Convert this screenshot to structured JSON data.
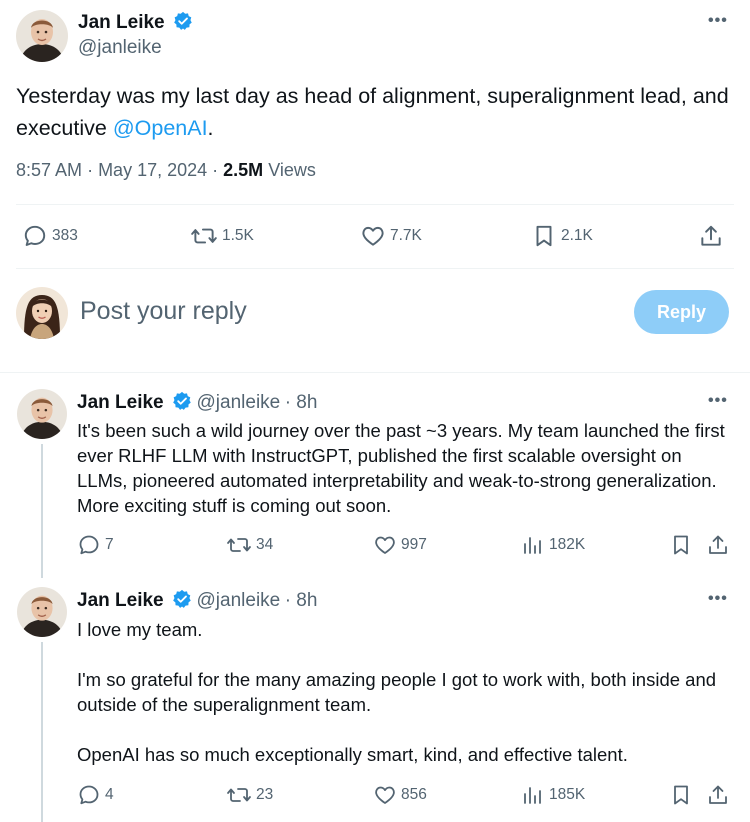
{
  "main_tweet": {
    "author_name": "Jan Leike",
    "author_handle": "@janleike",
    "text_prefix": "Yesterday was my last day as head of alignment, superalignment lead, and executive ",
    "mention": "@OpenAI",
    "text_suffix": ".",
    "time": "8:57 AM",
    "date": "May 17, 2024",
    "views_count": "2.5M",
    "views_label": "Views",
    "stats": {
      "replies": "383",
      "reposts": "1.5K",
      "likes": "7.7K",
      "bookmarks": "2.1K"
    }
  },
  "reply_box": {
    "placeholder": "Post your reply",
    "button_label": "Reply"
  },
  "replies": [
    {
      "author_name": "Jan Leike",
      "author_handle": "@janleike",
      "time_ago": "8h",
      "text": "It's been such a wild journey over the past ~3 years. My team launched the first ever RLHF LLM with InstructGPT, published the first scalable oversight on LLMs, pioneered automated interpretability and weak-to-strong generalization. More exciting stuff is coming out soon.",
      "stats": {
        "replies": "7",
        "reposts": "34",
        "likes": "997",
        "views": "182K"
      }
    },
    {
      "author_name": "Jan Leike",
      "author_handle": "@janleike",
      "time_ago": "8h",
      "text": "I love my team.\n\nI'm so grateful for the many amazing people I got to work with, both inside and outside of the superalignment team.\n\nOpenAI has so much exceptionally smart, kind, and effective talent.",
      "stats": {
        "replies": "4",
        "reposts": "23",
        "likes": "856",
        "views": "185K"
      }
    }
  ],
  "colors": {
    "accent": "#1d9bf0",
    "reply_button_disabled": "#8ecdf8",
    "secondary_text": "#536471",
    "primary_text": "#0f1419",
    "divider": "#eff3f4"
  },
  "icons": [
    "verified-badge-icon",
    "more-icon",
    "reply-icon",
    "repost-icon",
    "like-icon",
    "bookmark-icon",
    "share-icon",
    "views-icon"
  ]
}
